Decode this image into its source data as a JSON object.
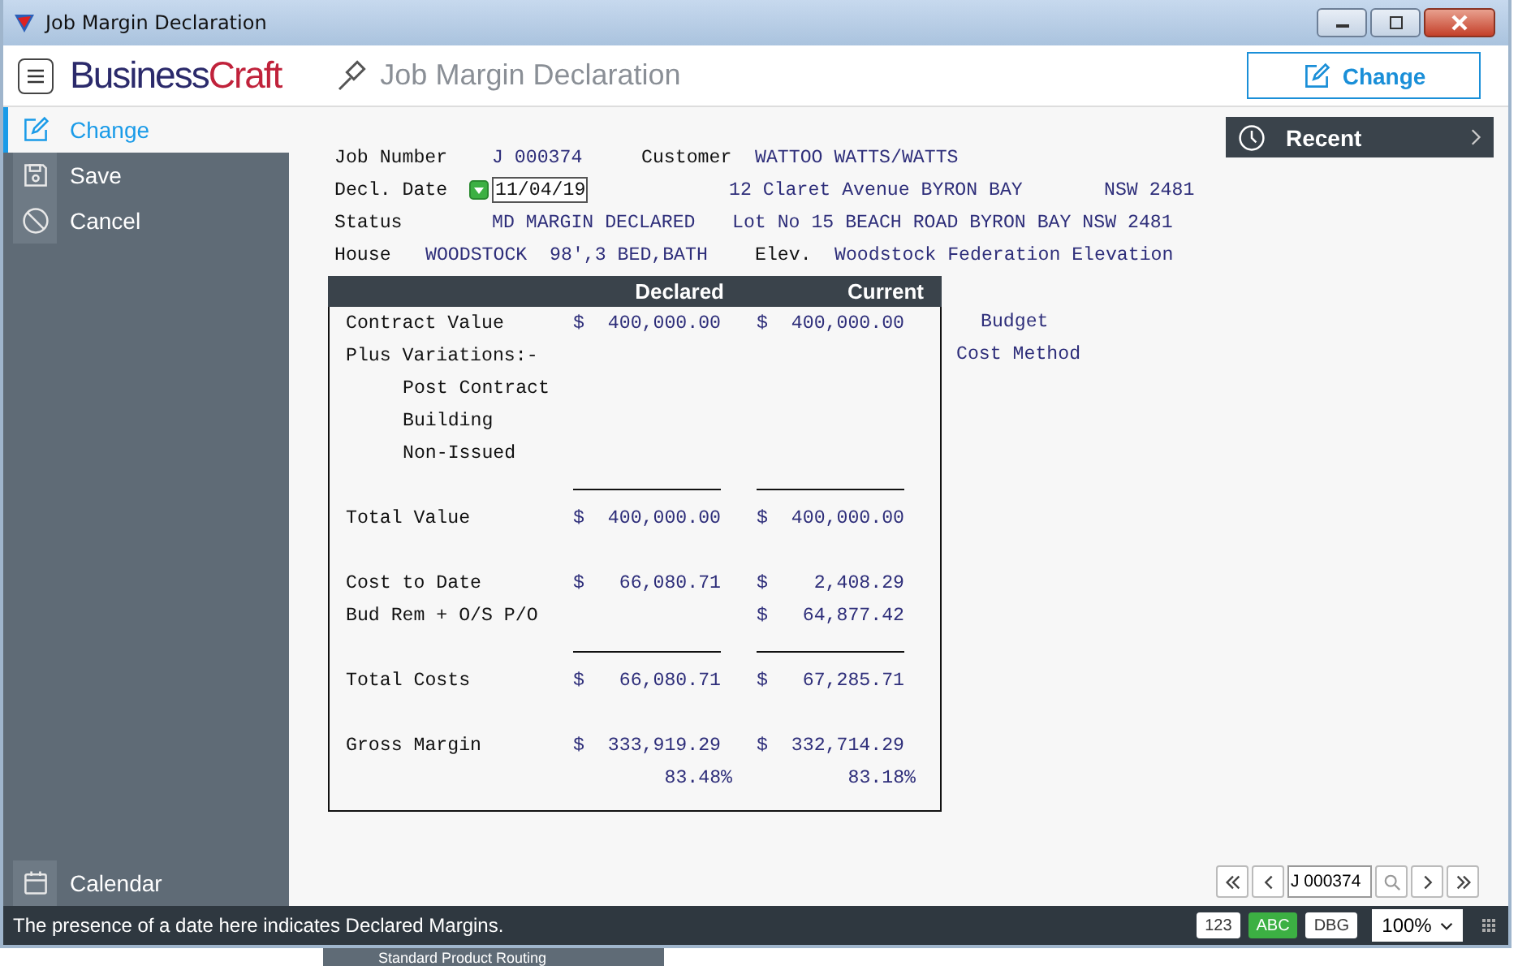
{
  "window": {
    "title": "Job Margin Declaration"
  },
  "header": {
    "logo": {
      "start": "Business",
      "end": "Craft"
    },
    "page_title": "Job Margin Declaration",
    "action_button": "Change"
  },
  "sidebar": {
    "items": [
      {
        "label": "Change",
        "kind": "edit",
        "selected": true
      },
      {
        "label": "Save",
        "kind": "save",
        "selected": false
      },
      {
        "label": "Cancel",
        "kind": "cancel",
        "selected": false
      }
    ],
    "bottom_item": {
      "label": "Calendar",
      "kind": "calendar"
    }
  },
  "details": {
    "job_number_label": "Job Number",
    "job_number": "J 000374",
    "customer_label": "Customer",
    "customer": "WATTOO WATTS/WATTS",
    "decl_date_label": "Decl. Date",
    "decl_date": "11/04/19",
    "address_line_1": "12 Claret Avenue BYRON BAY",
    "postcode": "NSW 2481",
    "status_label": "Status",
    "status": "MD MARGIN DECLARED",
    "address_line_2": "Lot No 15 BEACH ROAD BYRON BAY NSW 2481",
    "house_label": "House",
    "house": "WOODSTOCK  98',3 BED,BATH",
    "elevation_label": "Elev.",
    "elevation": "Woodstock Federation Elevation"
  },
  "table": {
    "columns": [
      {
        "label": "Declared"
      },
      {
        "label": "Current"
      }
    ],
    "rows": [
      {
        "kind": "amount",
        "label": "Contract Value",
        "declared": {
          "sign": "$",
          "value": "400,000.00"
        },
        "current": {
          "sign": "$",
          "value": "400,000.00"
        }
      },
      {
        "kind": "group",
        "label": "Plus Variations:-",
        "children": [
          {
            "label": "Post Contract"
          },
          {
            "label": "Building"
          },
          {
            "label": "Non-Issued"
          }
        ]
      },
      {
        "kind": "rule"
      },
      {
        "kind": "amount",
        "label": "Total Value",
        "declared": {
          "sign": "$",
          "value": "400,000.00"
        },
        "current": {
          "sign": "$",
          "value": "400,000.00"
        }
      },
      {
        "kind": "blank"
      },
      {
        "kind": "amount",
        "label": "Cost to Date",
        "declared": {
          "sign": "$",
          "value": "66,080.71"
        },
        "current": {
          "sign": "$",
          "value": "2,408.29"
        }
      },
      {
        "kind": "amount",
        "label": "Bud Rem + O/S P/O",
        "current": {
          "sign": "$",
          "value": "64,877.42"
        }
      },
      {
        "kind": "rule"
      },
      {
        "kind": "amount",
        "label": "Total Costs",
        "declared": {
          "sign": "$",
          "value": "66,080.71"
        },
        "current": {
          "sign": "$",
          "value": "67,285.71"
        }
      },
      {
        "kind": "blank"
      },
      {
        "kind": "amount",
        "label": "Gross Margin",
        "declared": {
          "sign": "$",
          "value": "333,919.29"
        },
        "current": {
          "sign": "$",
          "value": "332,714.29"
        }
      },
      {
        "kind": "percent",
        "declared": "83.48%",
        "current": "83.18%"
      }
    ]
  },
  "side_labels": [
    "Budget",
    "Cost Method"
  ],
  "recent": {
    "label": "Recent"
  },
  "navigator": {
    "record": "J 000374"
  },
  "status_bar": {
    "message": "The presence of a date here indicates Declared Margins.",
    "modes": [
      {
        "label": "123",
        "on": false
      },
      {
        "label": "ABC",
        "on": true
      },
      {
        "label": "DBG",
        "on": false
      }
    ],
    "zoom": "100%"
  },
  "background_window": {
    "title": "Standard Product Routing"
  }
}
